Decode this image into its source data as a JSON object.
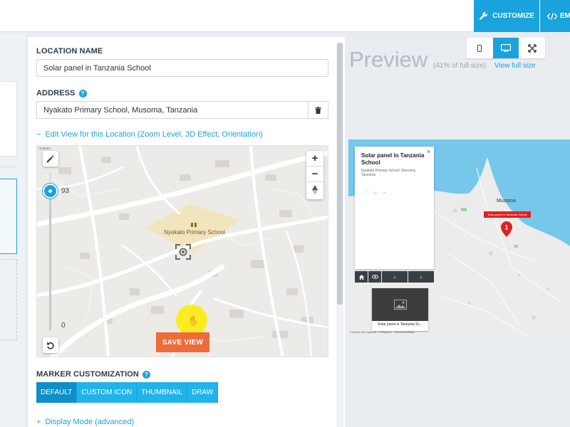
{
  "topbar": {
    "customize_label": "CUSTOMIZE",
    "embed_label": "EM",
    "accent_color": "#1aa3dd"
  },
  "location": {
    "name_label": "LOCATION NAME",
    "name_value": "Solar panel in Tanzania School",
    "address_label": "ADDRESS",
    "address_value": "Nyakato Primary School, Musoma, Tanzania",
    "edit_view_link": "Edit View for this Location (Zoom Level, 3D Effect, Orientation)",
    "edit_view_prefix": "−"
  },
  "map_editor": {
    "attribution": "nyakato",
    "school_label": "Nyakato Primary School",
    "zoom_in": "+",
    "zoom_out": "−",
    "slider_max": "93",
    "slider_min": "0",
    "slider_level": 93,
    "save_view_label": "SAVE VIEW",
    "save_view_color": "#ee6b3b"
  },
  "marker": {
    "label": "MARKER CUSTOMIZATION",
    "tabs": [
      "DEFAULT",
      "CUSTOM ICON",
      "THUMBNAIL",
      "DRAW"
    ],
    "active_tab": "DEFAULT"
  },
  "display_mode": {
    "prefix": "+",
    "label": "Display Mode (advanced)"
  },
  "preview": {
    "title": "Preview",
    "subtitle": "(41% of full size)",
    "link": "View full size",
    "card_title": "Solar panel in Tanzania School",
    "card_address": "Nyakato Primary School, Musoma, Tanzania",
    "close": "×",
    "city_label": "Musoma",
    "marker_label": "Solar panel in Tanzania School",
    "marker_number": "1",
    "thumb_caption": "Solar panel in Tanzania Sc...",
    "credit": "Created with Mapme · © Mapbox · OpenStreetMap",
    "nav_prev": "‹",
    "nav_next": "›"
  }
}
